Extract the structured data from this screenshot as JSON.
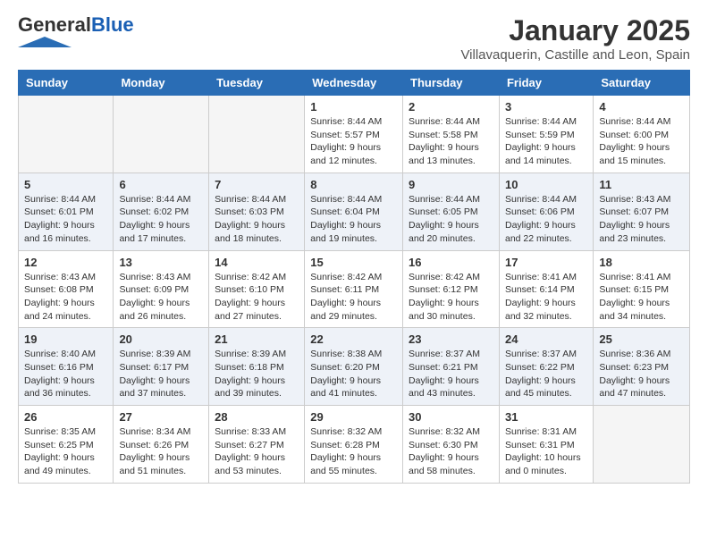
{
  "header": {
    "logo_general": "General",
    "logo_blue": "Blue",
    "month": "January 2025",
    "location": "Villavaquerin, Castille and Leon, Spain"
  },
  "weekdays": [
    "Sunday",
    "Monday",
    "Tuesday",
    "Wednesday",
    "Thursday",
    "Friday",
    "Saturday"
  ],
  "weeks": [
    [
      {
        "day": "",
        "info": ""
      },
      {
        "day": "",
        "info": ""
      },
      {
        "day": "",
        "info": ""
      },
      {
        "day": "1",
        "info": "Sunrise: 8:44 AM\nSunset: 5:57 PM\nDaylight: 9 hours and 12 minutes."
      },
      {
        "day": "2",
        "info": "Sunrise: 8:44 AM\nSunset: 5:58 PM\nDaylight: 9 hours and 13 minutes."
      },
      {
        "day": "3",
        "info": "Sunrise: 8:44 AM\nSunset: 5:59 PM\nDaylight: 9 hours and 14 minutes."
      },
      {
        "day": "4",
        "info": "Sunrise: 8:44 AM\nSunset: 6:00 PM\nDaylight: 9 hours and 15 minutes."
      }
    ],
    [
      {
        "day": "5",
        "info": "Sunrise: 8:44 AM\nSunset: 6:01 PM\nDaylight: 9 hours and 16 minutes."
      },
      {
        "day": "6",
        "info": "Sunrise: 8:44 AM\nSunset: 6:02 PM\nDaylight: 9 hours and 17 minutes."
      },
      {
        "day": "7",
        "info": "Sunrise: 8:44 AM\nSunset: 6:03 PM\nDaylight: 9 hours and 18 minutes."
      },
      {
        "day": "8",
        "info": "Sunrise: 8:44 AM\nSunset: 6:04 PM\nDaylight: 9 hours and 19 minutes."
      },
      {
        "day": "9",
        "info": "Sunrise: 8:44 AM\nSunset: 6:05 PM\nDaylight: 9 hours and 20 minutes."
      },
      {
        "day": "10",
        "info": "Sunrise: 8:44 AM\nSunset: 6:06 PM\nDaylight: 9 hours and 22 minutes."
      },
      {
        "day": "11",
        "info": "Sunrise: 8:43 AM\nSunset: 6:07 PM\nDaylight: 9 hours and 23 minutes."
      }
    ],
    [
      {
        "day": "12",
        "info": "Sunrise: 8:43 AM\nSunset: 6:08 PM\nDaylight: 9 hours and 24 minutes."
      },
      {
        "day": "13",
        "info": "Sunrise: 8:43 AM\nSunset: 6:09 PM\nDaylight: 9 hours and 26 minutes."
      },
      {
        "day": "14",
        "info": "Sunrise: 8:42 AM\nSunset: 6:10 PM\nDaylight: 9 hours and 27 minutes."
      },
      {
        "day": "15",
        "info": "Sunrise: 8:42 AM\nSunset: 6:11 PM\nDaylight: 9 hours and 29 minutes."
      },
      {
        "day": "16",
        "info": "Sunrise: 8:42 AM\nSunset: 6:12 PM\nDaylight: 9 hours and 30 minutes."
      },
      {
        "day": "17",
        "info": "Sunrise: 8:41 AM\nSunset: 6:14 PM\nDaylight: 9 hours and 32 minutes."
      },
      {
        "day": "18",
        "info": "Sunrise: 8:41 AM\nSunset: 6:15 PM\nDaylight: 9 hours and 34 minutes."
      }
    ],
    [
      {
        "day": "19",
        "info": "Sunrise: 8:40 AM\nSunset: 6:16 PM\nDaylight: 9 hours and 36 minutes."
      },
      {
        "day": "20",
        "info": "Sunrise: 8:39 AM\nSunset: 6:17 PM\nDaylight: 9 hours and 37 minutes."
      },
      {
        "day": "21",
        "info": "Sunrise: 8:39 AM\nSunset: 6:18 PM\nDaylight: 9 hours and 39 minutes."
      },
      {
        "day": "22",
        "info": "Sunrise: 8:38 AM\nSunset: 6:20 PM\nDaylight: 9 hours and 41 minutes."
      },
      {
        "day": "23",
        "info": "Sunrise: 8:37 AM\nSunset: 6:21 PM\nDaylight: 9 hours and 43 minutes."
      },
      {
        "day": "24",
        "info": "Sunrise: 8:37 AM\nSunset: 6:22 PM\nDaylight: 9 hours and 45 minutes."
      },
      {
        "day": "25",
        "info": "Sunrise: 8:36 AM\nSunset: 6:23 PM\nDaylight: 9 hours and 47 minutes."
      }
    ],
    [
      {
        "day": "26",
        "info": "Sunrise: 8:35 AM\nSunset: 6:25 PM\nDaylight: 9 hours and 49 minutes."
      },
      {
        "day": "27",
        "info": "Sunrise: 8:34 AM\nSunset: 6:26 PM\nDaylight: 9 hours and 51 minutes."
      },
      {
        "day": "28",
        "info": "Sunrise: 8:33 AM\nSunset: 6:27 PM\nDaylight: 9 hours and 53 minutes."
      },
      {
        "day": "29",
        "info": "Sunrise: 8:32 AM\nSunset: 6:28 PM\nDaylight: 9 hours and 55 minutes."
      },
      {
        "day": "30",
        "info": "Sunrise: 8:32 AM\nSunset: 6:30 PM\nDaylight: 9 hours and 58 minutes."
      },
      {
        "day": "31",
        "info": "Sunrise: 8:31 AM\nSunset: 6:31 PM\nDaylight: 10 hours and 0 minutes."
      },
      {
        "day": "",
        "info": ""
      }
    ]
  ]
}
